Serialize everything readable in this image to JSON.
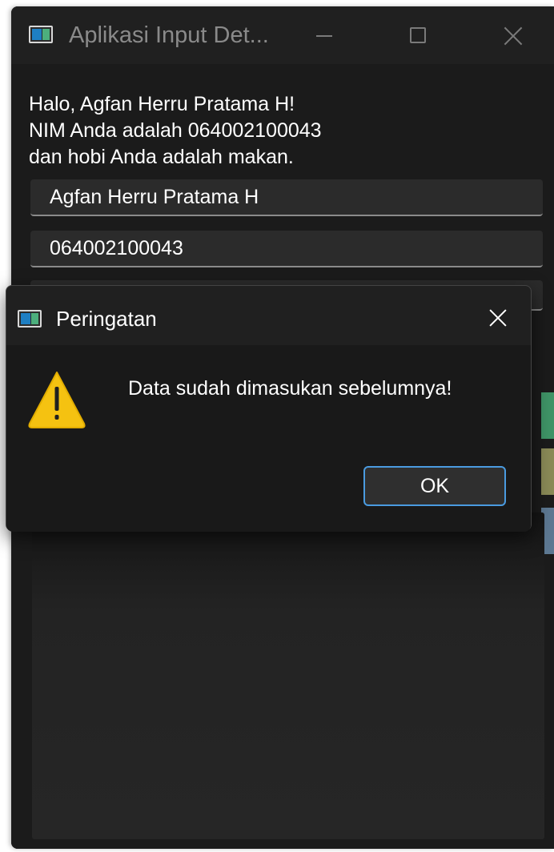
{
  "main_window": {
    "title": "Aplikasi Input Det...",
    "greeting_lines": [
      "Halo, Agfan Herru Pratama H!",
      "NIM Anda adalah 064002100043",
      "dan hobi Anda adalah makan."
    ],
    "fields": {
      "nama": "Agfan Herru Pratama H",
      "nim": "064002100043",
      "hobi": ""
    }
  },
  "dialog": {
    "title": "Peringatan",
    "message": "Data sudah dimasukan sebelumnya!",
    "ok_label": "OK"
  },
  "icons": {
    "app": "app-window-icon",
    "warning": "warning-triangle-icon",
    "minimize": "minimize-icon",
    "maximize": "maximize-icon",
    "close": "close-icon"
  },
  "colors": {
    "accent_border": "#4a9be0",
    "warning_yellow": "#f5c211",
    "button_green": "#3f9467",
    "button_olive": "#8a8a57",
    "button_blue": "#5d7892"
  }
}
